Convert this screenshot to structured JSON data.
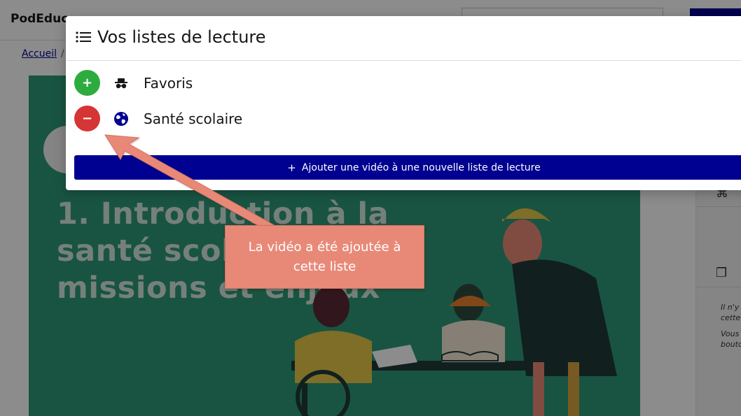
{
  "site": {
    "brand": "PodEduc",
    "breadcrumb_home": "Accueil",
    "breadcrumb_sep": "/"
  },
  "video": {
    "title": "1. Introduction à la santé scolaire : missions et enjeux",
    "background_color": "#2f9a78"
  },
  "side_panel": {
    "icons": [
      "gamepad-icon",
      "copy-icon"
    ],
    "text_1": "Il n'y … cette …",
    "text_2": "Vous … bouto…"
  },
  "modal": {
    "title": "Vos listes de lecture",
    "title_icon": "list-icon",
    "playlists": [
      {
        "label": "Favoris",
        "action": "add",
        "action_symbol": "+",
        "icon": "incognito-icon",
        "action_color": "#2eab3f"
      },
      {
        "label": "Santé scolaire",
        "action": "remove",
        "action_symbol": "−",
        "icon": "globe-icon",
        "action_color": "#d63535"
      }
    ],
    "new_list_button": "Ajouter une vidéo à une nouvelle liste de lecture",
    "new_list_button_icon": "plus-icon",
    "primary_color": "#000091"
  },
  "annotation": {
    "text": "La vidéo a été ajoutée à cette liste",
    "color": "#e88978"
  }
}
